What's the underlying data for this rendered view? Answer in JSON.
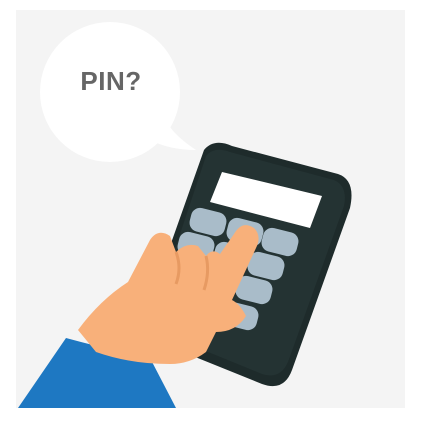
{
  "speech_bubble": {
    "text": "PIN?"
  },
  "colors": {
    "background_panel": "#f4f4f4",
    "bubble": "#ffffff",
    "bubble_text": "#666666",
    "terminal_body": "#1e2b2b",
    "terminal_edge": "#2c3a3a",
    "screen": "#ffffff",
    "key": "#a9bcc9",
    "key_shadow": "#7f95a4",
    "hand": "#f8b07a",
    "sleeve": "#1e78c2"
  },
  "icons": [
    "speech-bubble",
    "card-payment-terminal",
    "hand-pressing-key",
    "sleeve"
  ]
}
